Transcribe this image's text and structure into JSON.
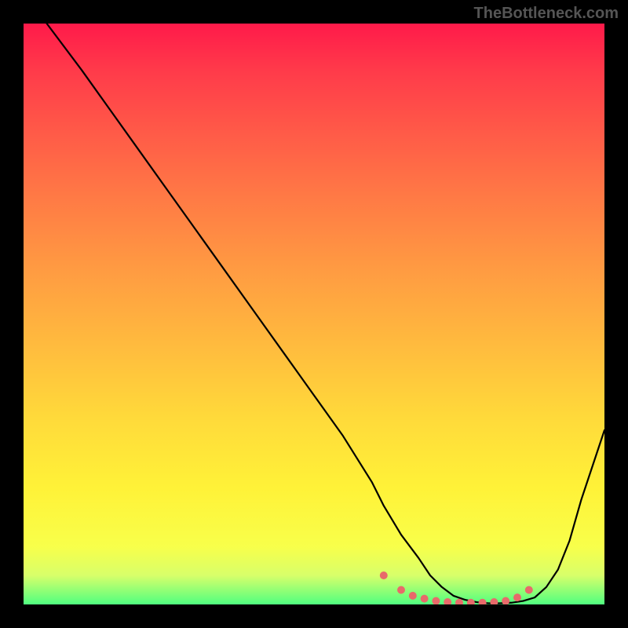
{
  "watermark": "TheBottleneck.com",
  "chart_data": {
    "type": "line",
    "title": "",
    "xlabel": "",
    "ylabel": "",
    "xlim": [
      0,
      100
    ],
    "ylim": [
      0,
      100
    ],
    "series": [
      {
        "name": "curve",
        "x": [
          4,
          10,
          15,
          20,
          25,
          30,
          35,
          40,
          45,
          50,
          55,
          60,
          62,
          65,
          68,
          70,
          72,
          74,
          76,
          78,
          80,
          82,
          84,
          86,
          88,
          90,
          92,
          94,
          96,
          100
        ],
        "y": [
          100,
          92,
          85,
          78,
          71,
          64,
          57,
          50,
          43,
          36,
          29,
          21,
          17,
          12,
          8,
          5,
          3,
          1.5,
          0.8,
          0.4,
          0.2,
          0.2,
          0.3,
          0.6,
          1.2,
          3,
          6,
          11,
          18,
          30
        ],
        "color": "#000000"
      },
      {
        "name": "valley-dots",
        "x": [
          62,
          65,
          67,
          69,
          71,
          73,
          75,
          77,
          79,
          81,
          83,
          85,
          87
        ],
        "y": [
          5,
          2.5,
          1.5,
          1,
          0.6,
          0.4,
          0.3,
          0.3,
          0.3,
          0.4,
          0.6,
          1.2,
          2.5
        ],
        "color": "#e86a6a"
      }
    ]
  }
}
